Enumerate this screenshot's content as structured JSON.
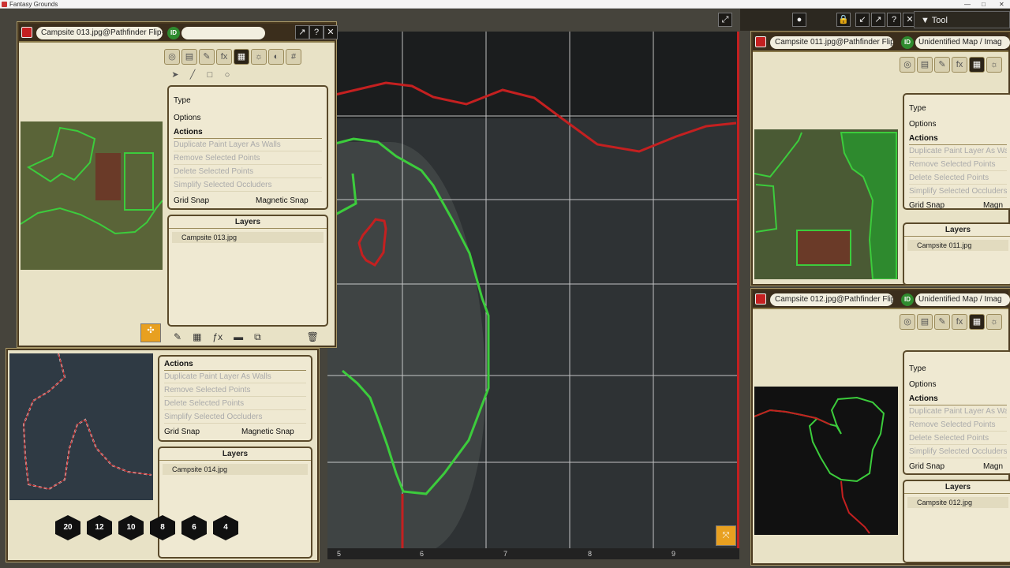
{
  "app": {
    "title": "Fantasy Grounds"
  },
  "window_controls": [
    "—",
    "□",
    "✕"
  ],
  "top_tool": {
    "label": "▼   Tool"
  },
  "panels": {
    "main": {
      "name": "Campsite 013.jpg@Pathfinder Flip-",
      "id_label": "ID",
      "type_label": "Type",
      "options_label": "Options",
      "actions_label": "Actions",
      "actions": [
        "Duplicate Paint Layer As Walls",
        "Remove Selected Points",
        "Delete Selected Points",
        "Simplify Selected Occluders"
      ],
      "grid_snap": "Grid Snap",
      "magnetic_snap": "Magnetic Snap",
      "layers_label": "Layers",
      "layer_item": "Campsite 013.jpg"
    },
    "lower_left": {
      "actions_label": "Actions",
      "actions": [
        "Duplicate Paint Layer As Walls",
        "Remove Selected Points",
        "Delete Selected Points",
        "Simplify Selected Occluders"
      ],
      "grid_snap": "Grid Snap",
      "magnetic_snap": "Magnetic Snap",
      "layers_label": "Layers",
      "layer_item": "Campsite 014.jpg"
    },
    "right_top": {
      "name": "Campsite 011.jpg@Pathfinder Flip-",
      "id_label": "ID",
      "id_field": "Unidentified Map / Imag",
      "type_label": "Type",
      "options_label": "Options",
      "actions_label": "Actions",
      "actions": [
        "Duplicate Paint Layer As Walls",
        "Remove Selected Points",
        "Delete Selected Points",
        "Simplify Selected Occluders"
      ],
      "grid_snap": "Grid Snap",
      "magnetic_snap": "Magn",
      "layers_label": "Layers",
      "layer_item": "Campsite 011.jpg"
    },
    "right_bottom": {
      "name": "Campsite 012.jpg@Pathfinder Flip-",
      "id_label": "ID",
      "id_field": "Unidentified Map / Imag",
      "type_label": "Type",
      "options_label": "Options",
      "actions_label": "Actions",
      "actions": [
        "Duplicate Paint Layer As Walls",
        "Remove Selected Points",
        "Delete Selected Points",
        "Simplify Selected Occluders"
      ],
      "grid_snap": "Grid Snap",
      "magnetic_snap": "Magn",
      "layers_label": "Layers",
      "layer_item": "Campsite 012.jpg"
    }
  },
  "ruler": [
    "5",
    "6",
    "7",
    "8",
    "9"
  ],
  "dice": [
    "20",
    "12",
    "10",
    "8",
    "6",
    "4"
  ],
  "colors": {
    "wall_red": "#c42020",
    "occluder_green": "#3ccc3c",
    "panel_bg": "#e8e2c6",
    "frame": "#4a3a20"
  }
}
